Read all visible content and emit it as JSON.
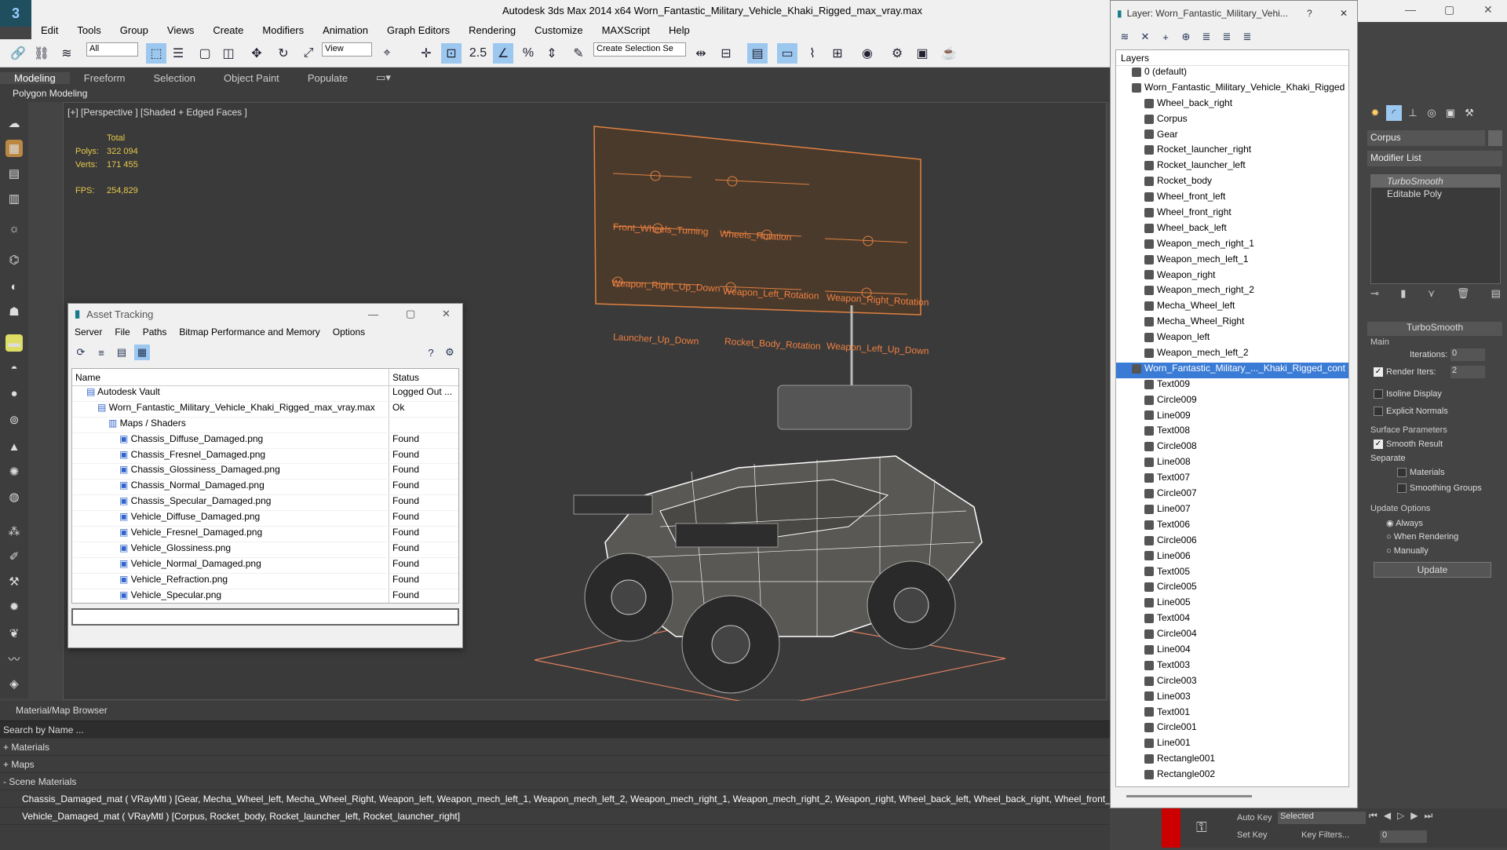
{
  "app": {
    "title": "Autodesk 3ds Max  2014 x64     Worn_Fantastic_Military_Vehicle_Khaki_Rigged_max_vray.max",
    "logo": "3"
  },
  "menu": [
    "Edit",
    "Tools",
    "Group",
    "Views",
    "Create",
    "Modifiers",
    "Animation",
    "Graph Editors",
    "Rendering",
    "Customize",
    "MAXScript",
    "Help"
  ],
  "toolbar": {
    "filter": "All",
    "refcoord": "View",
    "selset": "Create Selection Se",
    "snap": "2.5"
  },
  "ribbon": {
    "tabs": [
      "Modeling",
      "Freeform",
      "Selection",
      "Object Paint",
      "Populate"
    ],
    "active": "Modeling",
    "sub": "Polygon Modeling"
  },
  "viewport": {
    "label": "[+] [Perspective ] [Shaded + Edged Faces ]",
    "stats": {
      "total": "Total",
      "polys_label": "Polys:",
      "polys": "322 094",
      "verts_label": "Verts:",
      "verts": "171 455",
      "fps_label": "FPS:",
      "fps": "254,829"
    },
    "board": {
      "labels": [
        "Front_Wheels_Turning",
        "Wheels_Rotation",
        "Weapon_Right_Up_Down",
        "Weapon_Left_Rotation",
        "Weapon_Right_Rotation",
        "Launcher_Up_Down",
        "Rocket_Body_Rotation",
        "Weapon_Left_Up_Down"
      ]
    }
  },
  "asset": {
    "title": "Asset Tracking",
    "menu": [
      "Server",
      "File",
      "Paths",
      "Bitmap Performance and Memory",
      "Options"
    ],
    "cols": {
      "name": "Name",
      "status": "Status"
    },
    "rows": [
      {
        "name": "Autodesk Vault",
        "status": "Logged Out ...",
        "indent": 1
      },
      {
        "name": "Worn_Fantastic_Military_Vehicle_Khaki_Rigged_max_vray.max",
        "status": "Ok",
        "indent": 2
      },
      {
        "name": "Maps / Shaders",
        "status": "",
        "indent": 3
      },
      {
        "name": "Chassis_Diffuse_Damaged.png",
        "status": "Found",
        "indent": 4
      },
      {
        "name": "Chassis_Fresnel_Damaged.png",
        "status": "Found",
        "indent": 4
      },
      {
        "name": "Chassis_Glossiness_Damaged.png",
        "status": "Found",
        "indent": 4
      },
      {
        "name": "Chassis_Normal_Damaged.png",
        "status": "Found",
        "indent": 4
      },
      {
        "name": "Chassis_Specular_Damaged.png",
        "status": "Found",
        "indent": 4
      },
      {
        "name": "Vehicle_Diffuse_Damaged.png",
        "status": "Found",
        "indent": 4
      },
      {
        "name": "Vehicle_Fresnel_Damaged.png",
        "status": "Found",
        "indent": 4
      },
      {
        "name": "Vehicle_Glossiness.png",
        "status": "Found",
        "indent": 4
      },
      {
        "name": "Vehicle_Normal_Damaged.png",
        "status": "Found",
        "indent": 4
      },
      {
        "name": "Vehicle_Refraction.png",
        "status": "Found",
        "indent": 4
      },
      {
        "name": "Vehicle_Specular.png",
        "status": "Found",
        "indent": 4
      }
    ]
  },
  "layers": {
    "title": "Layer: Worn_Fantastic_Military_Vehi...",
    "header": "Layers",
    "items": [
      {
        "name": "0 (default)",
        "level": 1
      },
      {
        "name": "Worn_Fantastic_Military_Vehicle_Khaki_Rigged",
        "level": 1
      },
      {
        "name": "Wheel_back_right",
        "level": 2
      },
      {
        "name": "Corpus",
        "level": 2
      },
      {
        "name": "Gear",
        "level": 2
      },
      {
        "name": "Rocket_launcher_right",
        "level": 2
      },
      {
        "name": "Rocket_launcher_left",
        "level": 2
      },
      {
        "name": "Rocket_body",
        "level": 2
      },
      {
        "name": "Wheel_front_left",
        "level": 2
      },
      {
        "name": "Wheel_front_right",
        "level": 2
      },
      {
        "name": "Wheel_back_left",
        "level": 2
      },
      {
        "name": "Weapon_mech_right_1",
        "level": 2
      },
      {
        "name": "Weapon_mech_left_1",
        "level": 2
      },
      {
        "name": "Weapon_right",
        "level": 2
      },
      {
        "name": "Weapon_mech_right_2",
        "level": 2
      },
      {
        "name": "Mecha_Wheel_left",
        "level": 2
      },
      {
        "name": "Mecha_Wheel_Right",
        "level": 2
      },
      {
        "name": "Weapon_left",
        "level": 2
      },
      {
        "name": "Weapon_mech_left_2",
        "level": 2
      },
      {
        "name": "Worn_Fantastic_Military_..._Khaki_Rigged_cont",
        "level": 1,
        "selected": true
      },
      {
        "name": "Text009",
        "level": 2
      },
      {
        "name": "Circle009",
        "level": 2
      },
      {
        "name": "Line009",
        "level": 2
      },
      {
        "name": "Text008",
        "level": 2
      },
      {
        "name": "Circle008",
        "level": 2
      },
      {
        "name": "Line008",
        "level": 2
      },
      {
        "name": "Text007",
        "level": 2
      },
      {
        "name": "Circle007",
        "level": 2
      },
      {
        "name": "Line007",
        "level": 2
      },
      {
        "name": "Text006",
        "level": 2
      },
      {
        "name": "Circle006",
        "level": 2
      },
      {
        "name": "Line006",
        "level": 2
      },
      {
        "name": "Text005",
        "level": 2
      },
      {
        "name": "Circle005",
        "level": 2
      },
      {
        "name": "Line005",
        "level": 2
      },
      {
        "name": "Text004",
        "level": 2
      },
      {
        "name": "Circle004",
        "level": 2
      },
      {
        "name": "Line004",
        "level": 2
      },
      {
        "name": "Text003",
        "level": 2
      },
      {
        "name": "Circle003",
        "level": 2
      },
      {
        "name": "Line003",
        "level": 2
      },
      {
        "name": "Text001",
        "level": 2
      },
      {
        "name": "Circle001",
        "level": 2
      },
      {
        "name": "Line001",
        "level": 2
      },
      {
        "name": "Rectangle001",
        "level": 2
      },
      {
        "name": "Rectangle002",
        "level": 2
      }
    ]
  },
  "cmd": {
    "object": "Corpus",
    "modlist": "Modifier List",
    "stack": [
      "TurboSmooth",
      "Editable Poly"
    ],
    "rollout": "TurboSmooth",
    "main": "Main",
    "iter_label": "Iterations:",
    "iter": "0",
    "render_label": "Render Iters:",
    "render": "2",
    "isoline": "Isoline Display",
    "explicit": "Explicit Normals",
    "surface": "Surface Parameters",
    "smooth": "Smooth Result",
    "separate": "Separate",
    "materials": "Materials",
    "smoothing": "Smoothing Groups",
    "update_opts": "Update Options",
    "always": "Always",
    "when_rendering": "When Rendering",
    "manually": "Manually",
    "update": "Update"
  },
  "browser": {
    "title": "Material/Map Browser",
    "search": "Search by Name ...",
    "materials": "+ Materials",
    "maps": "+ Maps",
    "scene": "- Scene Materials",
    "mat1": "Chassis_Damaged_mat  ( VRayMtl ) [Gear, Mecha_Wheel_left, Mecha_Wheel_Right, Weapon_left, Weapon_mech_left_1, Weapon_mech_left_2, Weapon_mech_right_1, Weapon_mech_right_2, Weapon_right, Wheel_back_left, Wheel_back_right, Wheel_front_left, Wheel_front_right]",
    "mat2": "Vehicle_Damaged_mat  ( VRayMtl ) [Corpus, Rocket_body, Rocket_launcher_left, Rocket_launcher_right]"
  },
  "status": {
    "autokey": "Auto Key",
    "setkey": "Set Key",
    "selected": "Selected",
    "keyfilters": "Key Filters...",
    "frame": "0"
  }
}
